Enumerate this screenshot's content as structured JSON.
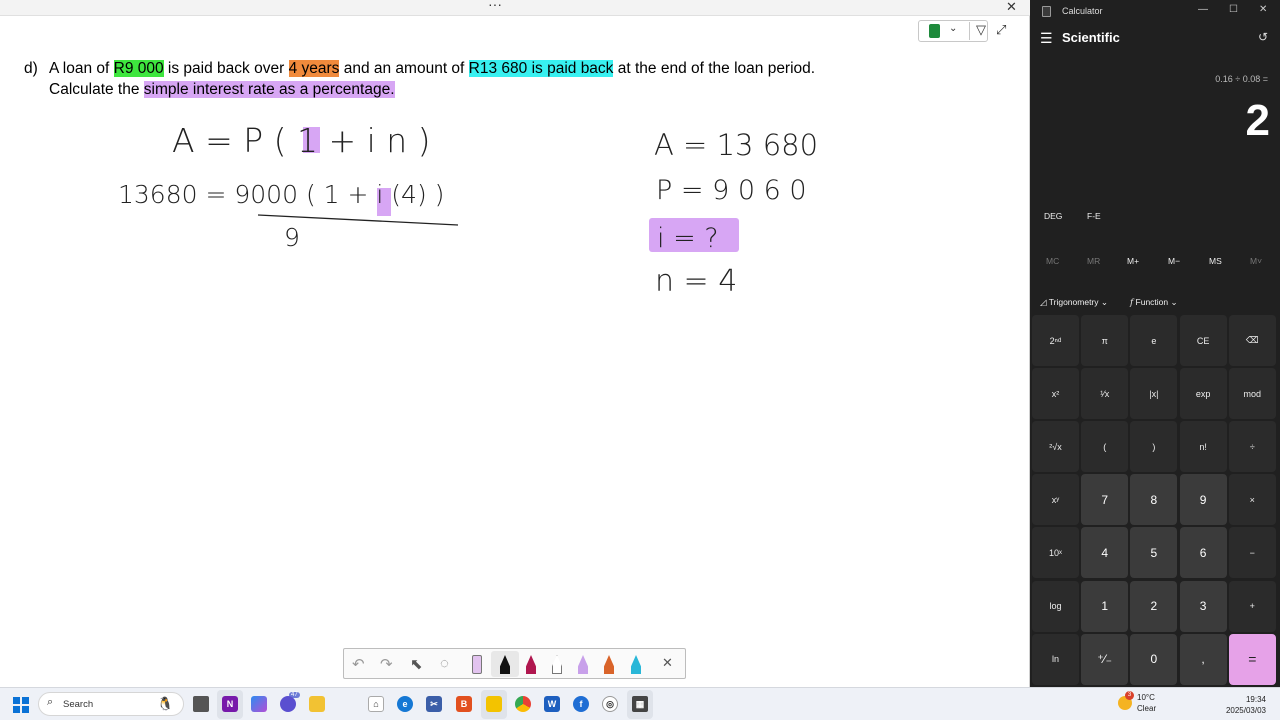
{
  "notebook": {
    "topbar": {
      "dots": "···",
      "close": "✕"
    },
    "question": {
      "letter": "d)",
      "line1": [
        {
          "text": "A loan of ",
          "hl": ""
        },
        {
          "text": "R9 000",
          "hl": "green"
        },
        {
          "text": " is paid back over ",
          "hl": ""
        },
        {
          "text": "4 years",
          "hl": "orange"
        },
        {
          "text": " and an amount of ",
          "hl": ""
        },
        {
          "text": "R13 680 is paid back",
          "hl": "cyan"
        },
        {
          "text": " at the end of the loan period.",
          "hl": ""
        }
      ],
      "line2": [
        {
          "text": "Calculate the ",
          "hl": ""
        },
        {
          "text": "simple interest rate as a percentage.",
          "hl": "purple"
        }
      ]
    },
    "handwriting": {
      "formula": "A = P ( 1 + i n )",
      "substitution": "13680  =  9000 ( 1 +  i (4) )",
      "divisor": "9",
      "given_A": "A =  13 680",
      "given_P": "P = 9 0 6 0",
      "given_i": "i = ?",
      "given_n": "n = 4"
    }
  },
  "calculator": {
    "title": "Calculator",
    "mode": "Scientific",
    "expression": "0.16 ÷ 0.08 =",
    "display": "2",
    "angle_unit": "DEG",
    "fe_label": "F-E",
    "memory": [
      "MC",
      "MR",
      "M+",
      "M−",
      "MS",
      "M˅"
    ],
    "menus": {
      "trig": "Trigonometry",
      "func": "Function"
    },
    "keys": [
      [
        "2ⁿᵈ",
        "π",
        "e",
        "CE",
        "⌫"
      ],
      [
        "x²",
        "¹⁄x",
        "|x|",
        "exp",
        "mod"
      ],
      [
        "²√x",
        "(",
        ")",
        "n!",
        "÷"
      ],
      [
        "xʸ",
        "7",
        "8",
        "9",
        "×"
      ],
      [
        "10ˣ",
        "4",
        "5",
        "6",
        "−"
      ],
      [
        "log",
        "1",
        "2",
        "3",
        "+"
      ],
      [
        "ln",
        "⁺⁄₋",
        "0",
        ",",
        "="
      ]
    ]
  },
  "taskbar": {
    "search_placeholder": "Search",
    "weather_temp": "10°C",
    "weather_cond": "Clear",
    "weather_badge": "3",
    "time": "19:34",
    "date": "2025/03/03",
    "chat_badge": "47"
  }
}
